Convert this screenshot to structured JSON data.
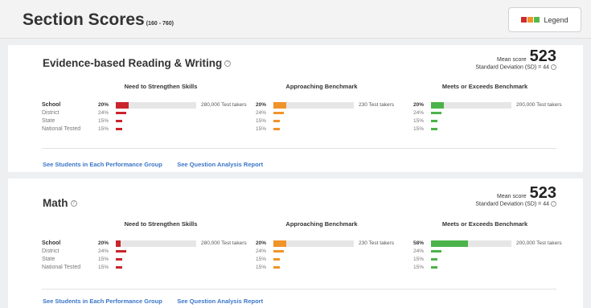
{
  "header": {
    "title": "Section Scores",
    "range": "(160 - 760)",
    "legend_label": "Legend",
    "legend_colors": [
      "#d12b2b",
      "#f0942a",
      "#55b84a"
    ]
  },
  "columns": [
    "Need to Strengthen Skills",
    "Approaching Benchmark",
    "Meets or Exceeds Benchmark"
  ],
  "colors": {
    "need": "#c9252c",
    "approaching": "#f0942a",
    "meets": "#4cb34a"
  },
  "sections": [
    {
      "title": "Evidence-based Reading & Writing",
      "mean_label": "Mean score",
      "mean_score": "523",
      "sd_text": "Standard Deviation (SD) = 44",
      "rows": [
        {
          "label": "School",
          "cells": [
            {
              "pct": "20%",
              "level": 0.2,
              "takers": "280,000 Test takers"
            },
            {
              "pct": "20%",
              "level": 0.2,
              "takers": "230 Test takers"
            },
            {
              "pct": "20%",
              "level": 0.2,
              "takers": "200,000 Test takers"
            }
          ]
        },
        {
          "label": "District",
          "cells": [
            {
              "pct": "24%",
              "level": 0.24
            },
            {
              "pct": "24%",
              "level": 0.24
            },
            {
              "pct": "24%",
              "level": 0.24
            }
          ]
        },
        {
          "label": "State",
          "cells": [
            {
              "pct": "15%",
              "level": 0.15
            },
            {
              "pct": "15%",
              "level": 0.15
            },
            {
              "pct": "15%",
              "level": 0.15
            }
          ]
        },
        {
          "label": "National Tested",
          "cells": [
            {
              "pct": "15%",
              "level": 0.15
            },
            {
              "pct": "15%",
              "level": 0.15
            },
            {
              "pct": "15%",
              "level": 0.15
            }
          ]
        }
      ],
      "links": [
        "See Students in Each Performance Group",
        "See Question Analysis Report"
      ]
    },
    {
      "title": "Math",
      "mean_label": "Mean score",
      "mean_score": "523",
      "sd_text": "Standard Deviation (SD) = 44",
      "rows": [
        {
          "label": "School",
          "cells": [
            {
              "pct": "20%",
              "level": 0.08,
              "takers": "280,000 Test takers"
            },
            {
              "pct": "20%",
              "level": 0.2,
              "takers": "230 Test takers"
            },
            {
              "pct": "58%",
              "level": 0.58,
              "takers": "200,000 Test takers"
            }
          ]
        },
        {
          "label": "District",
          "cells": [
            {
              "pct": "24%",
              "level": 0.24
            },
            {
              "pct": "24%",
              "level": 0.24
            },
            {
              "pct": "24%",
              "level": 0.24
            }
          ]
        },
        {
          "label": "State",
          "cells": [
            {
              "pct": "15%",
              "level": 0.15
            },
            {
              "pct": "15%",
              "level": 0.15
            },
            {
              "pct": "15%",
              "level": 0.15
            }
          ]
        },
        {
          "label": "National Tested",
          "cells": [
            {
              "pct": "15%",
              "level": 0.15
            },
            {
              "pct": "15%",
              "level": 0.15
            },
            {
              "pct": "15%",
              "level": 0.15
            }
          ]
        }
      ],
      "links": [
        "See Students in Each Performance Group",
        "See Question Analysis Report"
      ]
    }
  ]
}
